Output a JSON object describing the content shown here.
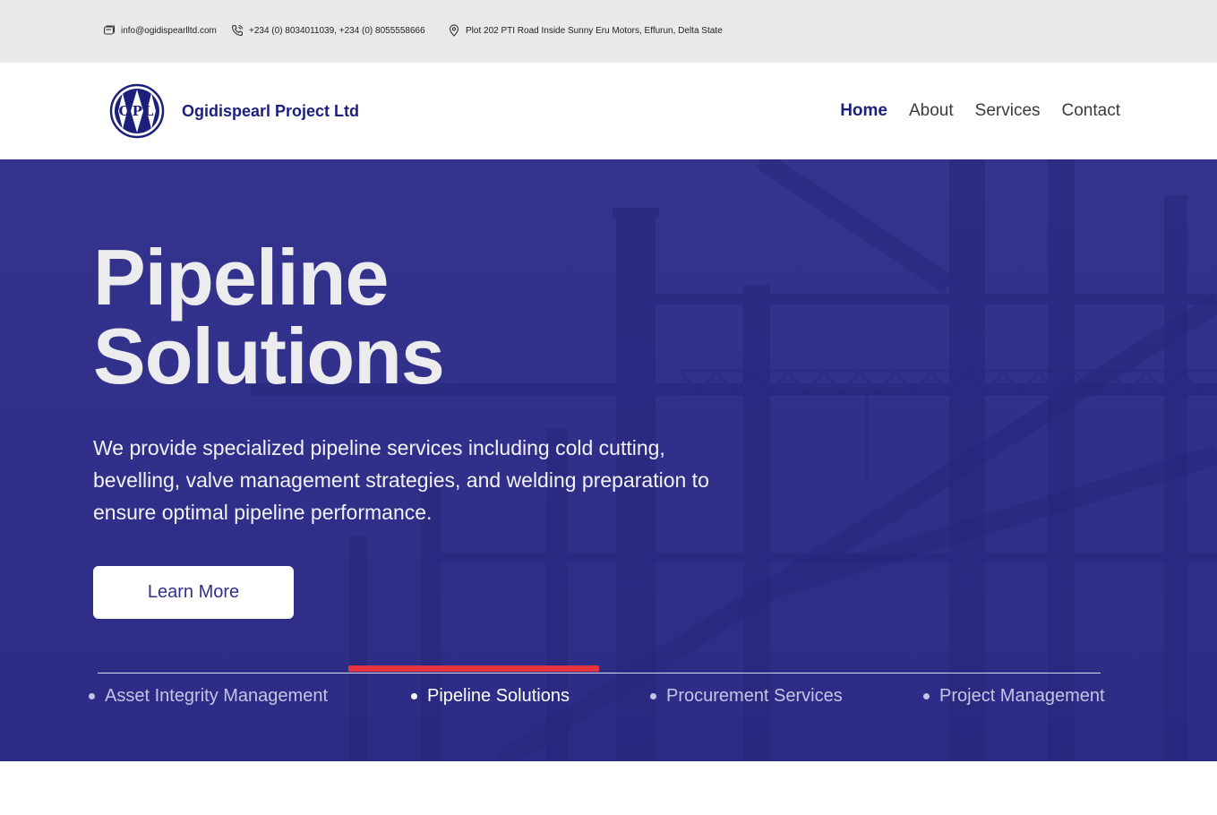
{
  "topbar": {
    "email": "info@ogidispearlltd.com",
    "phone": "+234 (0) 8034011039, +234 (0) 8055558666",
    "address": "Plot 202 PTI Road Inside Sunny Eru Motors, Effurun, Delta State",
    "icons": [
      "email-icon",
      "phone-icon",
      "location-pin-icon"
    ]
  },
  "header": {
    "logo_text": "OPL",
    "brand_name": "Ogidispearl Project Ltd",
    "nav": [
      {
        "label": "Home",
        "active": true
      },
      {
        "label": "About",
        "active": false
      },
      {
        "label": "Services",
        "active": false
      },
      {
        "label": "Contact",
        "active": false
      }
    ]
  },
  "hero": {
    "title_line1": "Pipeline",
    "title_line2": "Solutions",
    "description": "We provide specialized pipeline services including cold cutting, bevelling, valve management strategies, and welding preparation to ensure optimal pipeline performance.",
    "button_label": "Learn More",
    "tabs": [
      {
        "label": "Asset Integrity Management",
        "active": false
      },
      {
        "label": "Pipeline Solutions",
        "active": true
      },
      {
        "label": "Procurement Services",
        "active": false
      },
      {
        "label": "Project Management",
        "active": false
      }
    ]
  },
  "colors": {
    "brand": "#1c1f7c",
    "hero_overlay": "#2f2f8c",
    "accent": "#e5333f",
    "topbar_bg": "#e9e9ea"
  }
}
